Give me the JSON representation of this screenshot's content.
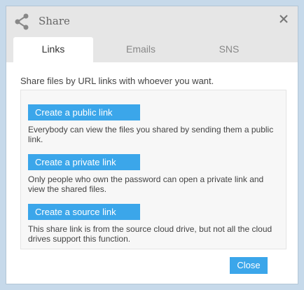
{
  "dialog": {
    "title": "Share",
    "icons": {
      "header": "share-icon",
      "close": "close-icon"
    }
  },
  "tabs": [
    {
      "label": "Links",
      "active": true
    },
    {
      "label": "Emails",
      "active": false
    },
    {
      "label": "SNS",
      "active": false
    }
  ],
  "links_panel": {
    "intro": "Share files by URL links with whoever you want.",
    "options": [
      {
        "button": "Create a public link",
        "description": "Everybody can view the files you shared by sending them a public link."
      },
      {
        "button": "Create a private link",
        "description": "Only people who own the password can open a private link and view the shared files."
      },
      {
        "button": "Create a source link",
        "description": "This share link is from the source cloud drive, but not all the cloud drives support this function."
      }
    ]
  },
  "footer": {
    "close_label": "Close"
  },
  "colors": {
    "accent": "#3ba6ea",
    "backdrop": "#c6d9ea",
    "header_bg": "#e6e6e6"
  }
}
